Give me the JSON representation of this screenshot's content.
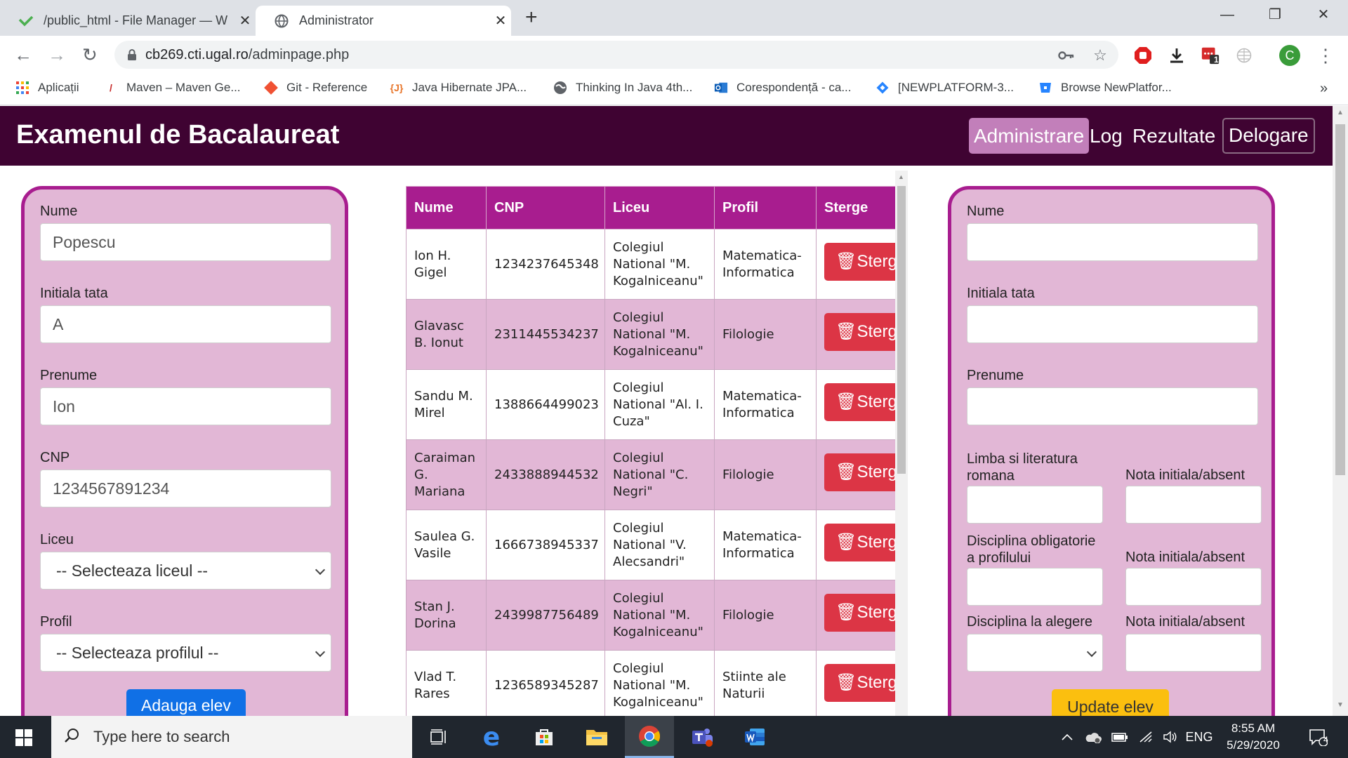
{
  "browser": {
    "tabs": [
      {
        "title": "/public_html - File Manager — W",
        "icon": "checkmark-icon",
        "active": false
      },
      {
        "title": "Administrator",
        "icon": "globe-icon",
        "active": true
      }
    ],
    "url_host": "cb269.cti.ugal.ro",
    "url_path": "/adminpage.php",
    "bookmarks": [
      {
        "label": "Aplicații",
        "icon": "apps-grid-icon"
      },
      {
        "label": "Maven – Maven Ge...",
        "icon": "maven-feather-icon"
      },
      {
        "label": "Git - Reference",
        "icon": "git-icon"
      },
      {
        "label": "Java Hibernate JPA...",
        "icon": "java-icon"
      },
      {
        "label": "Thinking In Java 4th...",
        "icon": "globe-icon"
      },
      {
        "label": "Corespondență - ca...",
        "icon": "outlook-icon"
      },
      {
        "label": "[NEWPLATFORM-3...",
        "icon": "jira-icon"
      },
      {
        "label": "Browse NewPlatfor...",
        "icon": "bitbucket-icon"
      }
    ],
    "bookmarks_overflow": "»",
    "profile_initial": "C",
    "ext_badge": "1"
  },
  "navbar": {
    "brand": "Examenul de Bacalaureat",
    "links": {
      "admin": "Administrare",
      "log": "Log",
      "results": "Rezultate",
      "logout": "Delogare"
    }
  },
  "add_form": {
    "nume_label": "Nume",
    "nume_value": "Popescu",
    "initiala_label": "Initiala tata",
    "initiala_value": "A",
    "prenume_label": "Prenume",
    "prenume_value": "Ion",
    "cnp_label": "CNP",
    "cnp_value": "1234567891234",
    "liceu_label": "Liceu",
    "liceu_selected": "-- Selecteaza liceul --",
    "profil_label": "Profil",
    "profil_selected": "-- Selecteaza profilul --",
    "submit_label": "Adauga elev"
  },
  "students_table": {
    "headers": [
      "Nume",
      "CNP",
      "Liceu",
      "Profil",
      "Sterge"
    ],
    "delete_label": "Sterge",
    "rows": [
      {
        "nume": "Ion H. Gigel",
        "cnp": "1234237645348",
        "liceu": "Colegiul National \"M. Kogalniceanu\"",
        "profil": "Matematica-Informatica"
      },
      {
        "nume": "Glavasc B. Ionut",
        "cnp": "2311445534237",
        "liceu": "Colegiul National \"M. Kogalniceanu\"",
        "profil": "Filologie"
      },
      {
        "nume": "Sandu M. Mirel",
        "cnp": "1388664499023",
        "liceu": "Colegiul National \"Al. I. Cuza\"",
        "profil": "Matematica-Informatica"
      },
      {
        "nume": "Caraiman G. Mariana",
        "cnp": "2433888944532",
        "liceu": "Colegiul National \"C. Negri\"",
        "profil": "Filologie"
      },
      {
        "nume": "Saulea G. Vasile",
        "cnp": "1666738945337",
        "liceu": "Colegiul National \"V. Alecsandri\"",
        "profil": "Matematica-Informatica"
      },
      {
        "nume": "Stan J. Dorina",
        "cnp": "2439987756489",
        "liceu": "Colegiul National \"M. Kogalniceanu\"",
        "profil": "Filologie"
      },
      {
        "nume": "Vlad T. Rares",
        "cnp": "1236589345287",
        "liceu": "Colegiul National \"M. Kogalniceanu\"",
        "profil": "Stiinte ale Naturii"
      }
    ]
  },
  "update_form": {
    "nume_label": "Nume",
    "initiala_label": "Initiala tata",
    "prenume_label": "Prenume",
    "limba_label": "Limba si literatura romana",
    "nota1_label": "Nota initiala/absent",
    "disc_obl_label": "Disciplina obligatorie a profilului",
    "nota2_label": "Nota initiala/absent",
    "disc_alegere_label": "Disciplina la alegere",
    "nota3_label": "Nota initiala/absent",
    "submit_label": "Update elev"
  },
  "taskbar": {
    "search_placeholder": "Type here to search",
    "language": "ENG",
    "time": "8:55 AM",
    "date": "5/29/2020",
    "notifications": "4"
  },
  "colors": {
    "navbar": "#3f0332",
    "accent": "#a81d8f",
    "panel": "#e2b7d6",
    "delete": "#dc3545",
    "add": "#1070e6",
    "update": "#fbbf0f"
  }
}
